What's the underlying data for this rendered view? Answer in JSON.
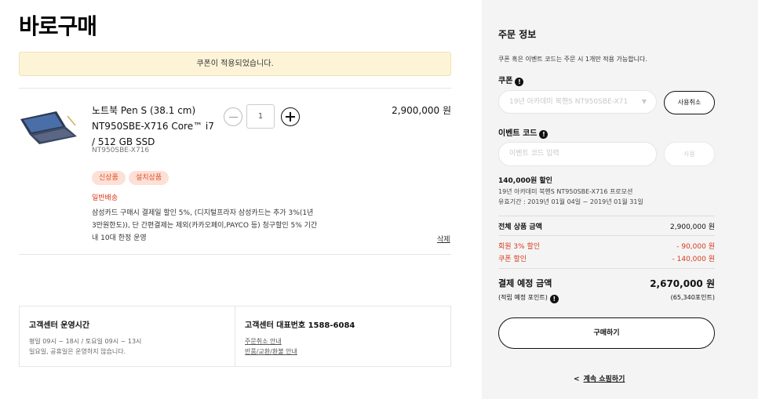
{
  "page_title": "바로구매",
  "coupon_notice": "쿠폰이 적용되었습니다.",
  "product": {
    "name": "노트북 Pen S (38.1 cm) NT950SBE-X716 Core™ i7 / 512 GB SSD",
    "code": "NT950SBE-X716",
    "quantity": "1",
    "price": "2,900,000 원",
    "badges": [
      "신상품",
      "설치상품"
    ],
    "shipping": "일반배송",
    "benefit_text": "삼성카드 구매시 결제일 할인 5%, (디지털프라자 삼성카드는 추가 3%(1년 3만원한도)), 단 간편결제는 제외(카카오페이,PAYCO 등) 청구할인 5% 기간내 10대 한정 운영",
    "delete_label": "삭제"
  },
  "customer_service": {
    "hours_title": "고객센터 운영시간",
    "hours_line1": "평일 09시 ~ 18시 / 토요일 09시 ~ 13시",
    "hours_line2": "일요일, 공휴일은 운영하지 않습니다.",
    "phone_title": "고객센터 대표번호 1588-6084",
    "link1": "주문취소 안내",
    "link2": "반품/교환/환불 안내"
  },
  "order_info": {
    "title": "주문 정보",
    "desc": "쿠폰 혹은 이벤트 코드는 주문 시 1개만 적용 가능합니다.",
    "coupon_label": "쿠폰",
    "coupon_selected": "19년 아카데미 북핸S NT950SBE-X71",
    "coupon_cancel": "사용취소",
    "event_label": "이벤트 코드",
    "event_placeholder": "이벤트 코드 입력",
    "event_use": "사용",
    "discount_title": "140,000원 할인",
    "discount_desc": "19년 아카데미 북핸S NT950SBE-X716 프로모션",
    "discount_period": "유효기간 : 2019년 01월 04일 ~ 2019년 01월 31일",
    "total_label": "전체 상품 금액",
    "total_value": "2,900,000 원",
    "member_label": "회원 3% 할인",
    "member_value": "- 90,000 원",
    "coupon_disc_label": "쿠폰 할인",
    "coupon_disc_value": "- 140,000 원",
    "pay_label": "결제 예정 금액",
    "pay_value": "2,670,000 원",
    "points_label": "(적립 예정 포인트)",
    "points_value": "(65,340포인트)",
    "buy_button": "구매하기",
    "continue_label": "계속 쇼핑하기"
  },
  "colors": {
    "accent_red": "#d83a1b",
    "notice_bg": "#fdf4d8",
    "badge_bg": "#fde0d6",
    "panel_bg": "#f4f4f4"
  },
  "icons": [
    "minus-circle-icon",
    "plus-circle-icon",
    "info-icon",
    "chevron-down-icon",
    "chevron-left-icon"
  ]
}
